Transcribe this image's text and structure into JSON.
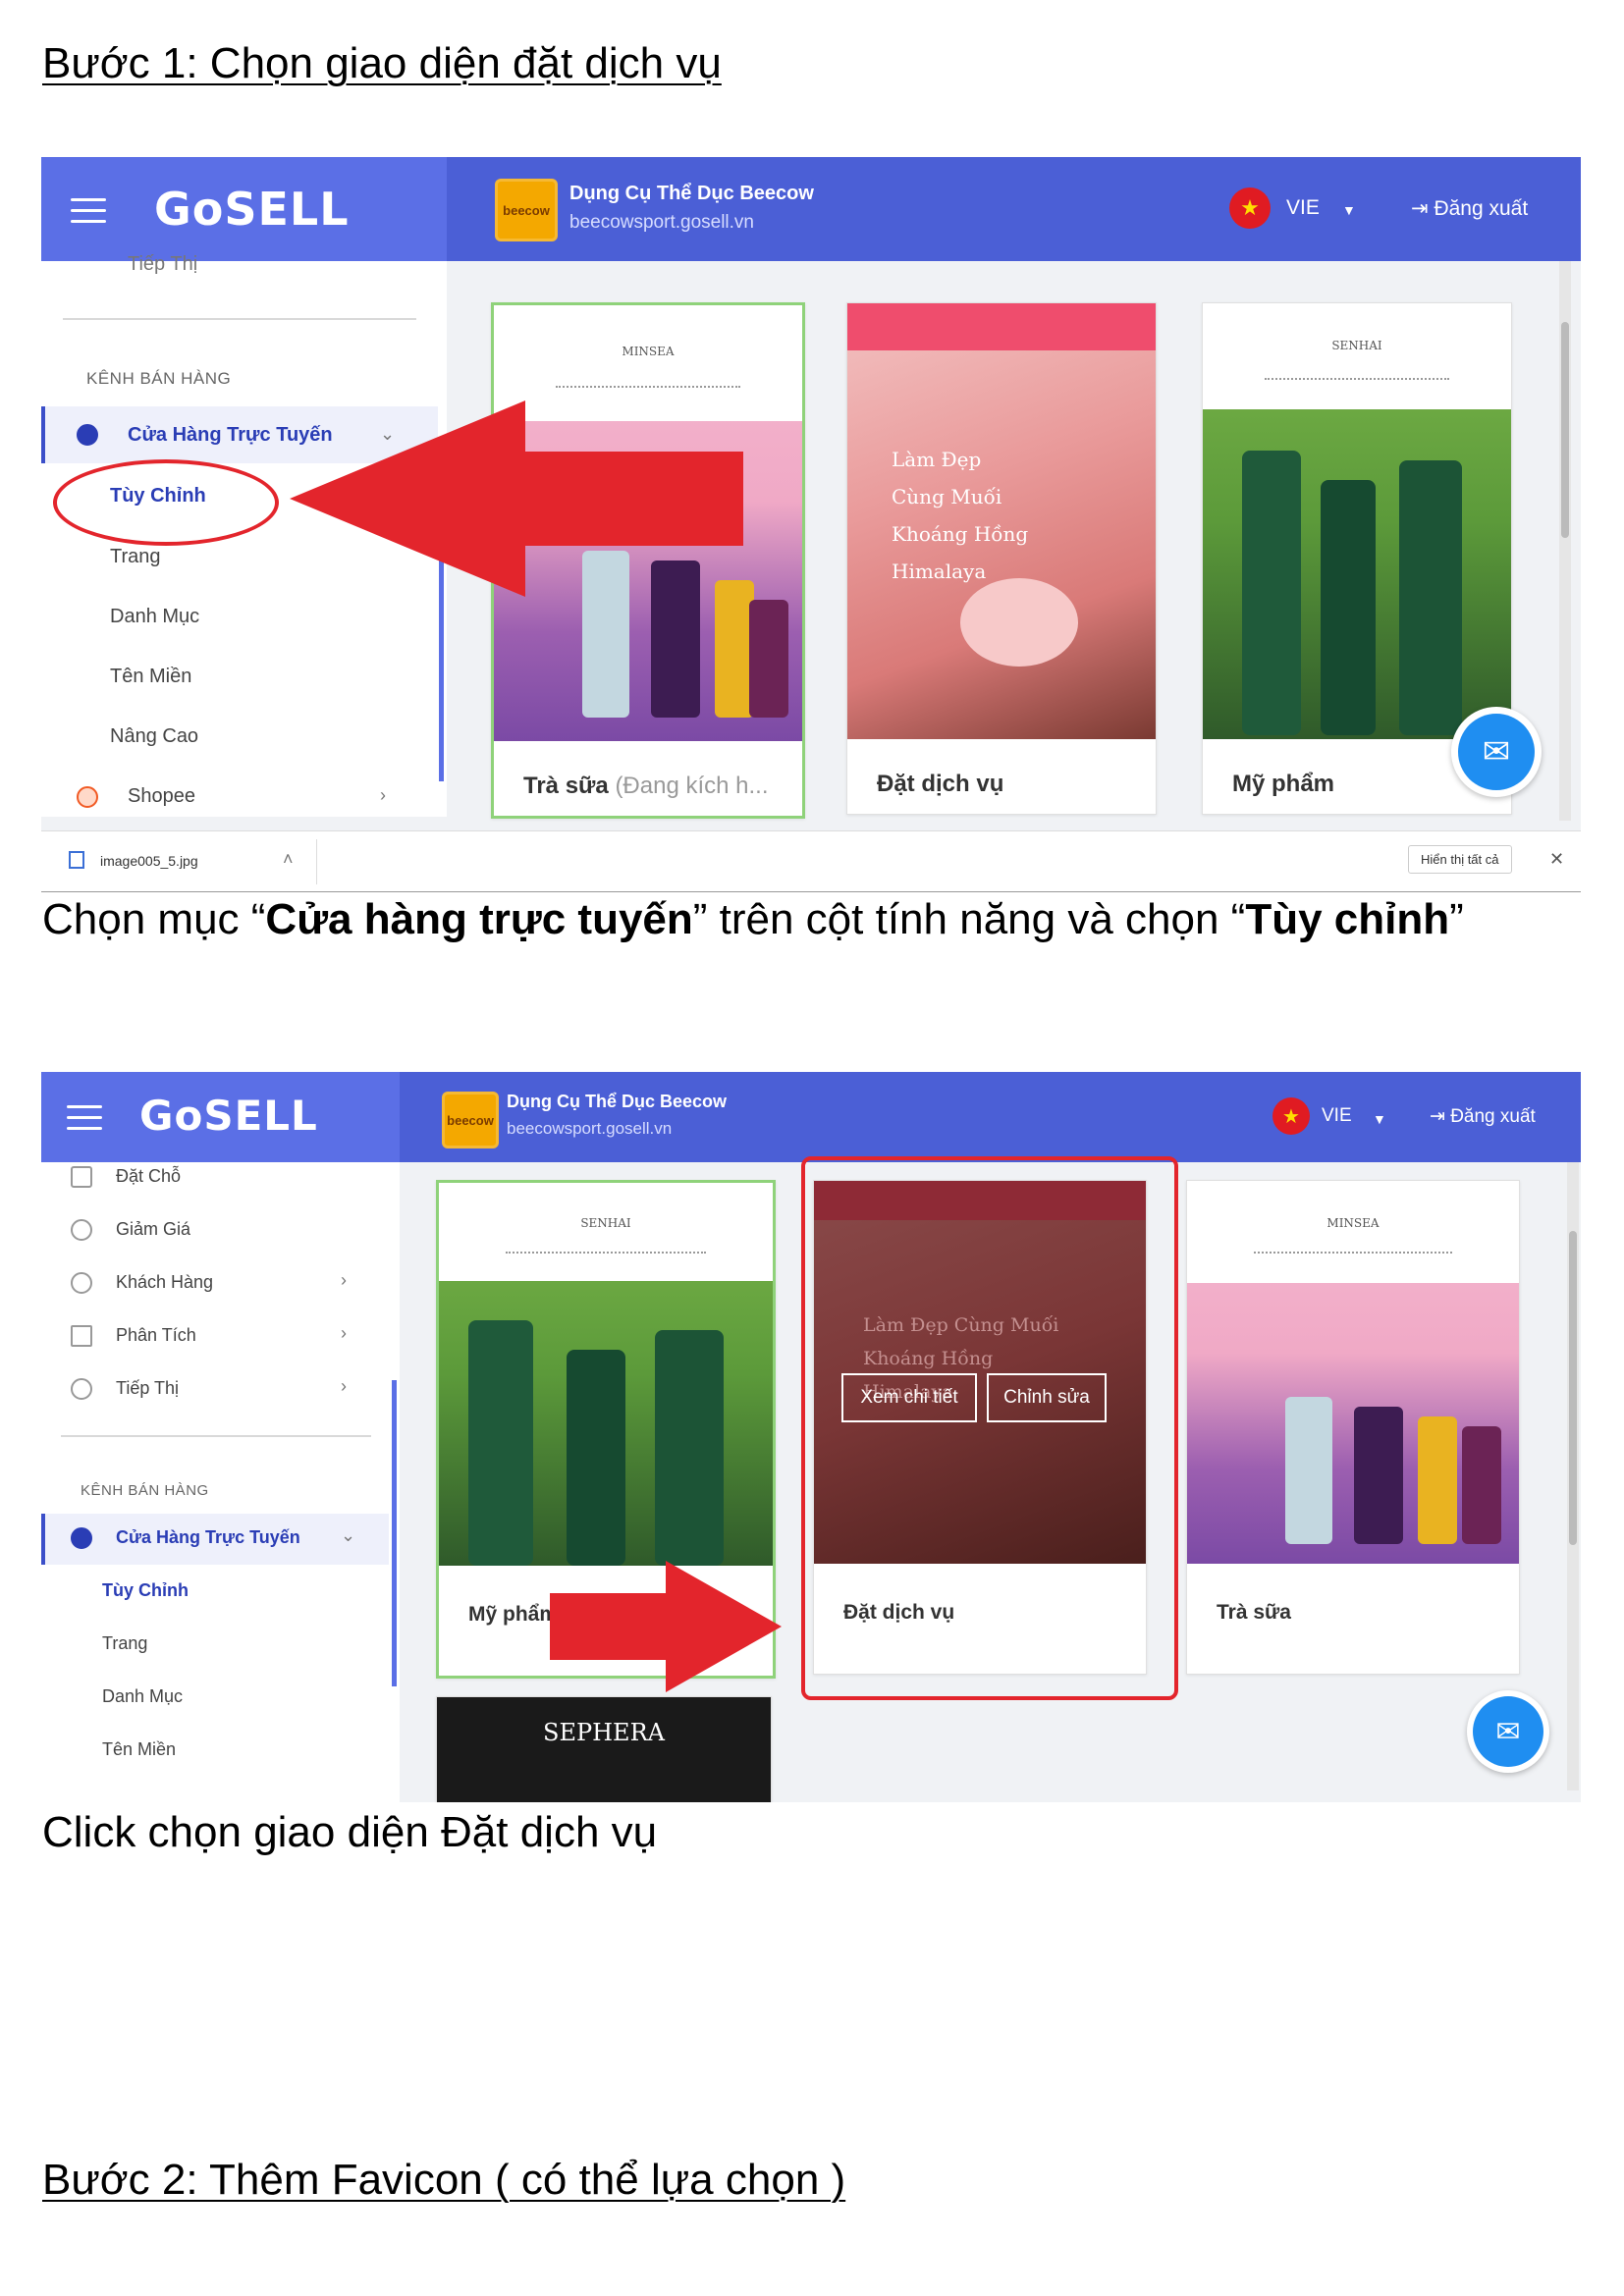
{
  "heading1": "Bước 1: Chọn giao diện đặt dịch vụ ",
  "caption1": {
    "part1": "Chọn mục “",
    "bold1": "Cửa hàng trực tuyến",
    "part2": "” trên cột tính năng và chọn “",
    "bold2": "Tùy chỉnh",
    "part3": "”"
  },
  "caption2": "Click chọn giao diện Đặt dịch vụ",
  "heading2": "Bước 2: Thêm Favicon ( có thể lựa chọn )",
  "app": {
    "logo": "GoSELL",
    "store_badge": "beecow",
    "store_name": "Dụng Cụ Thể Dục Beecow",
    "store_url": "beecowsport.gosell.vn",
    "flag": "★",
    "lang": "VIE",
    "logout": "Đăng xuất",
    "messenger": "✉",
    "sidebar_section": "KÊNH BÁN HÀNG",
    "online_store": "Cửa Hàng Trực Tuyến",
    "customize": "Tùy Chỉnh",
    "pages": "Trang",
    "menus": "Danh Mục",
    "domains": "Tên Miền",
    "advanced": "Nâng Cao",
    "shopee": "Shopee",
    "marketing_cut": "Tiếp Thị",
    "booking": "Đặt Chỗ",
    "discount": "Giảm Giá",
    "customers": "Khách Hàng",
    "analytics": "Phân Tích",
    "marketing": "Tiếp Thị"
  },
  "themes1": [
    {
      "label": "Trà sữa",
      "suffix": "(Đang kích h..."
    },
    {
      "label": "Đặt dịch vụ",
      "suffix": ""
    },
    {
      "label": "Mỹ phẩm",
      "suffix": ""
    }
  ],
  "themes2": [
    {
      "label": "Mỹ phẩm"
    },
    {
      "label": "Đặt dịch vụ"
    },
    {
      "label": "Trà sữa"
    }
  ],
  "thumb_text": {
    "minsea": "MINSEA",
    "senhai": "SENHAI",
    "spa_title": "Làm Đẹp Cùng Muối Khoáng Hồng Himalaya",
    "sephera": "SEPHERA"
  },
  "overlay": {
    "view": "Xem chi tiết",
    "edit": "Chỉnh sửa"
  },
  "download_bar": {
    "file": "image005_5.jpg",
    "show_all": "Hiển thị tất cả",
    "close": "✕"
  },
  "colors": {
    "brand": "#4b5fd6",
    "arrow_red": "#e3252c",
    "selected_green": "#8fd27a"
  }
}
